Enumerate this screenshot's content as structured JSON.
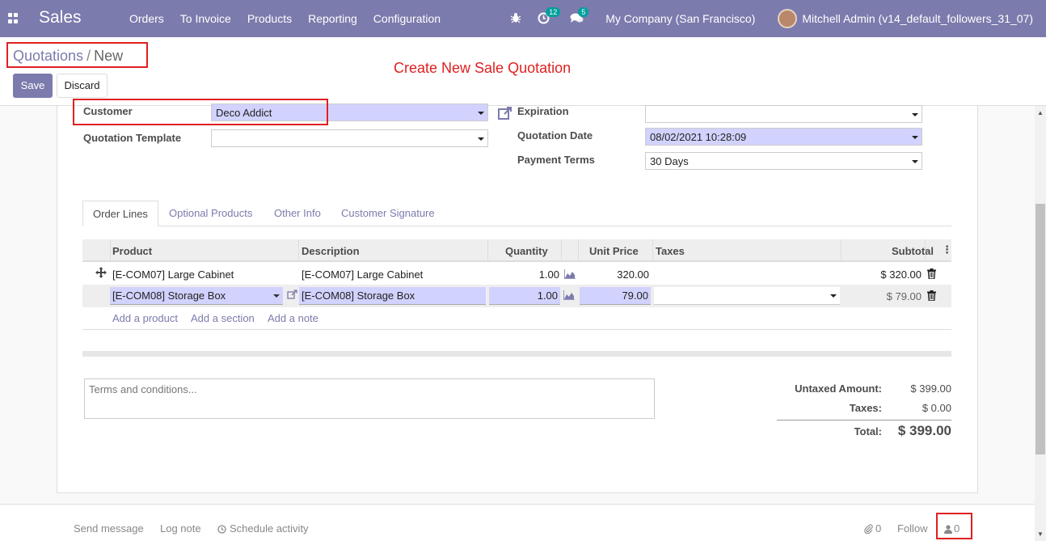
{
  "navbar": {
    "brand": "Sales",
    "menu": [
      "Orders",
      "To Invoice",
      "Products",
      "Reporting",
      "Configuration"
    ],
    "activity_count": "12",
    "message_count": "5",
    "company": "My Company (San Francisco)",
    "user": "Mitchell Admin (v14_default_followers_31_07)"
  },
  "breadcrumb": {
    "parent": "Quotations",
    "separator": "/",
    "current": "New"
  },
  "annotation": "Create New Sale Quotation",
  "buttons": {
    "save": "Save",
    "discard": "Discard"
  },
  "form": {
    "customer_label": "Customer",
    "customer_value": "Deco Addict",
    "template_label": "Quotation Template",
    "template_value": "",
    "expiration_label": "Expiration",
    "expiration_value": "",
    "quotation_date_label": "Quotation Date",
    "quotation_date_value": "08/02/2021 10:28:09",
    "payment_terms_label": "Payment Terms",
    "payment_terms_value": "30 Days"
  },
  "tabs": [
    "Order Lines",
    "Optional Products",
    "Other Info",
    "Customer Signature"
  ],
  "table": {
    "headers": [
      "Product",
      "Description",
      "Quantity",
      "Unit Price",
      "Taxes",
      "Subtotal"
    ],
    "rows": [
      {
        "product": "[E-COM07] Large Cabinet",
        "description": "[E-COM07] Large Cabinet",
        "quantity": "1.00",
        "unit_price": "320.00",
        "taxes": "",
        "subtotal": "$ 320.00"
      },
      {
        "product": "[E-COM08] Storage Box",
        "description": "[E-COM08] Storage Box",
        "quantity": "1.00",
        "unit_price": "79.00",
        "taxes": "",
        "subtotal": "$ 79.00"
      }
    ],
    "add_product": "Add a product",
    "add_section": "Add a section",
    "add_note": "Add a note"
  },
  "terms_placeholder": "Terms and conditions...",
  "totals": {
    "untaxed_label": "Untaxed Amount:",
    "untaxed_value": "$ 399.00",
    "taxes_label": "Taxes:",
    "taxes_value": "$ 0.00",
    "total_label": "Total:",
    "total_value": "$ 399.00"
  },
  "chatter": {
    "send_message": "Send message",
    "log_note": "Log note",
    "schedule_activity": "Schedule activity",
    "attachments": "0",
    "follow": "Follow",
    "followers": "0"
  },
  "colors": {
    "primary": "#7c7bad",
    "annotation_red": "#e02020",
    "required_field": "#d2d2ff"
  }
}
